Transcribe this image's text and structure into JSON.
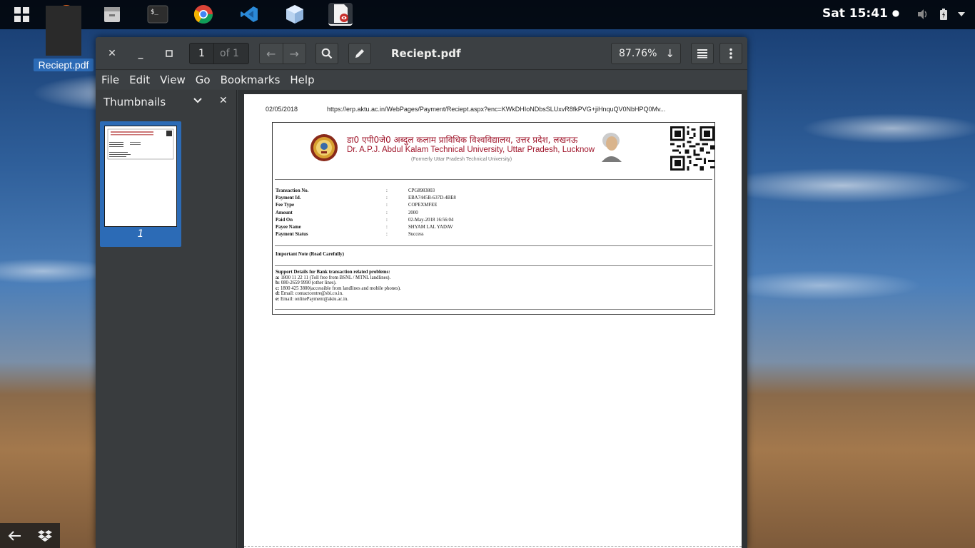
{
  "topbar": {
    "clock": "Sat 15:41",
    "clock_dot": "●",
    "dock": [
      {
        "name": "firefox-icon"
      },
      {
        "name": "files-icon"
      },
      {
        "name": "terminal-icon",
        "label": "$_"
      },
      {
        "name": "chrome-icon"
      },
      {
        "name": "vscode-icon"
      },
      {
        "name": "box-icon"
      },
      {
        "name": "document-viewer-icon"
      }
    ]
  },
  "desktop": {
    "icon_label": "Reciept.pdf"
  },
  "window": {
    "title": "Reciept.pdf",
    "page_number": "1",
    "page_of": "of 1",
    "zoom": "87.76%",
    "menu": [
      "File",
      "Edit",
      "View",
      "Go",
      "Bookmarks",
      "Help"
    ],
    "sidebar_title": "Thumbnails",
    "thumbnail_label": "1"
  },
  "document": {
    "date": "02/05/2018",
    "url": "https://erp.aktu.ac.in/WebPages/Payment/Reciept.aspx?enc=KWkDHIoNDbsSLUxvR8fkPVG+jiHnquQV0NbHPQ0Mv...",
    "university_hindi": "डा0 एपी0जे0 अब्दुल कलाम प्राविधिक विश्वविद्यालय, उत्तर प्रदेश, लखनऊ",
    "university_english": "Dr. A.P.J. Abdul Kalam Technical University, Uttar Pradesh, Lucknow",
    "university_former": "(Formerly Uttar Pradesh Technical University)",
    "fields": [
      {
        "label": "Transaction No.",
        "sep": ":",
        "value": "CPG8983803"
      },
      {
        "label": "Payment Id.",
        "sep": ":",
        "value": "EBA7445B-637D-4BE8"
      },
      {
        "label": "Fee Type",
        "sep": ":",
        "value": "COPEXMFEE"
      },
      {
        "label": "Amount",
        "sep": ":",
        "value": "2000"
      },
      {
        "label": "Paid On",
        "sep": ":",
        "value": "02-May-2018 16:56:04"
      },
      {
        "label": "Payee Name",
        "sep": ":",
        "value": "SHYAM LAL YADAV"
      },
      {
        "label": "Payment Status",
        "sep": ":",
        "value": "Success"
      }
    ],
    "important_note": "Important Note (Read Carefully)",
    "support_title": "Support Details for Bank transaction related problems:",
    "support_lines": [
      {
        "key": "a:",
        "text": "1800 11 22 11 (Toll free from BSNL / MTNL landlines)."
      },
      {
        "key": "b:",
        "text": "080-2659 9990 (other lines)."
      },
      {
        "key": "c:",
        "text": "1800 425 3800(accessible from landlines and mobile phones)."
      },
      {
        "key": "d:",
        "text": "Email: contactcentre@sbi.co.in."
      },
      {
        "key": "e:",
        "text": "Email: onlinePayment@aktu.ac.in."
      }
    ]
  }
}
